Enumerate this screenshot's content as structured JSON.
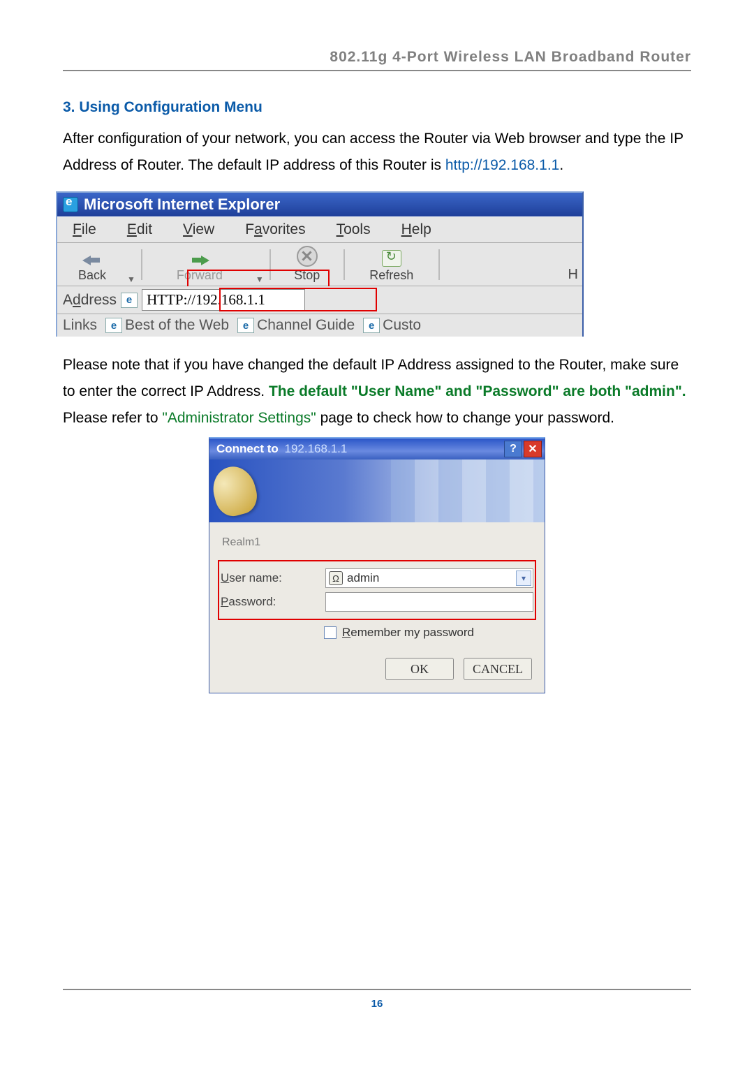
{
  "doc": {
    "header": "802.11g 4-Port Wireless LAN Broadband Router",
    "section_title": "3. Using Configuration Menu",
    "p1a": "After configuration of your network, you can access the Router via Web browser and type the IP Address of Router. The default IP address of this Router is ",
    "p1_link": "http://192.168.1.1",
    "p1b": ".",
    "p2a": "Please note that if you have changed the default IP Address assigned to the Router, make sure to enter the correct IP Address. ",
    "p2_bold": "The default \"User Name\" and \"Password\" are both \"admin\".",
    "p2b": " Please refer to ",
    "p2_green": "\"Administrator Settings\"",
    "p2c": " page to check how to change your password.",
    "page_number": "16"
  },
  "ie": {
    "title": "Microsoft Internet Explorer",
    "menu": {
      "file": "File",
      "edit": "Edit",
      "view": "View",
      "favorites": "Favorites",
      "tools": "Tools",
      "help": "Help"
    },
    "tool": {
      "back": "Back",
      "forward": "Forward",
      "stop": "Stop",
      "refresh": "Refresh",
      "home_initial": "H"
    },
    "addr_label": "Address",
    "address": "HTTP://192.168.1.1",
    "links_label": "Links",
    "links": {
      "l1": "Best of the Web",
      "l2": "Channel Guide",
      "l3": "Custo"
    }
  },
  "dlg": {
    "title": "Connect to",
    "ip": "192.168.1.1",
    "realm": "Realm1",
    "user_label": "User name:",
    "pass_label": "Password:",
    "user_value": "admin",
    "remember": "Remember my password",
    "ok": "OK",
    "cancel": "CANCEL"
  }
}
